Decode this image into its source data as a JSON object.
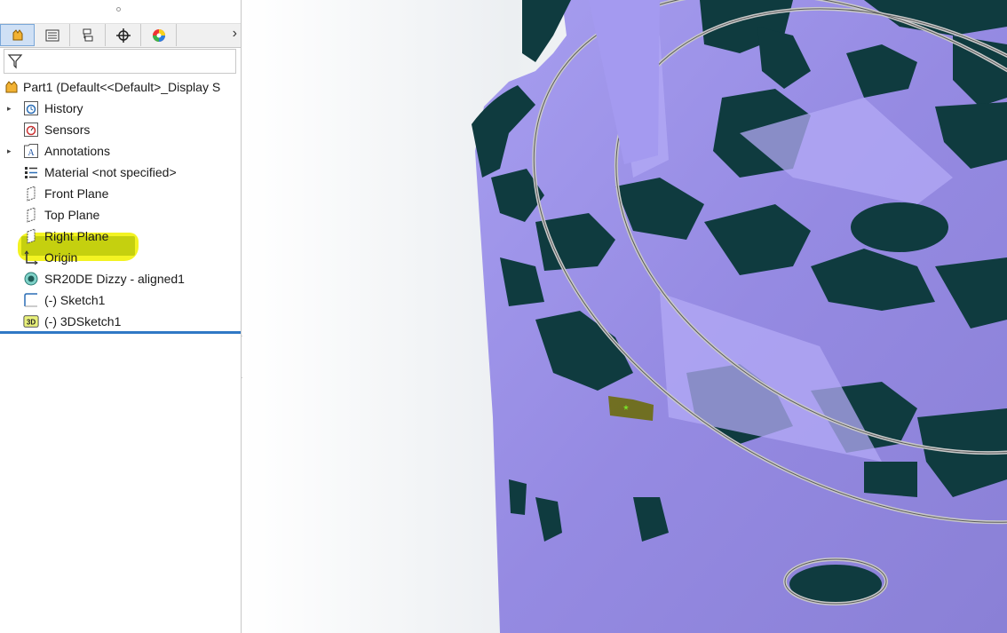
{
  "feature_tree": {
    "tabs": [
      {
        "icon": "feature-manager-icon"
      },
      {
        "icon": "property-manager-icon"
      },
      {
        "icon": "configuration-manager-icon"
      },
      {
        "icon": "dimxpert-manager-icon"
      },
      {
        "icon": "display-manager-icon"
      }
    ],
    "more_tabs_glyph": "›",
    "filter_icon": "filter-icon",
    "root": "Part1  (Default<<Default>_Display S",
    "items": [
      {
        "label": "History",
        "icon": "history-icon",
        "expandable": true
      },
      {
        "label": "Sensors",
        "icon": "sensors-icon",
        "expandable": false
      },
      {
        "label": "Annotations",
        "icon": "annotations-icon",
        "expandable": true
      },
      {
        "label": "Material <not specified>",
        "icon": "material-icon",
        "expandable": false
      },
      {
        "label": "Front Plane",
        "icon": "plane-icon",
        "expandable": false
      },
      {
        "label": "Top Plane",
        "icon": "plane-icon",
        "expandable": false
      },
      {
        "label": "Right Plane",
        "icon": "plane-icon",
        "expandable": false
      },
      {
        "label": "Origin",
        "icon": "origin-icon",
        "expandable": false
      },
      {
        "label": "SR20DE Dizzy - aligned1",
        "icon": "mesh-body-icon",
        "expandable": false
      },
      {
        "label": "(-) Sketch1",
        "icon": "sketch-icon",
        "expandable": false
      },
      {
        "label": "(-) 3DSketch1",
        "icon": "3d-sketch-icon",
        "expandable": false,
        "selected": true
      }
    ],
    "sketch3d_icon_text": "3D",
    "annotations_icon_text": "A"
  },
  "colors": {
    "highlight": "#f3f322",
    "mesh_light": "#9d92e6",
    "mesh_dark": "#0f3b3f",
    "divider": "#2f78c5"
  },
  "viewport": {
    "point_marker": "*"
  }
}
